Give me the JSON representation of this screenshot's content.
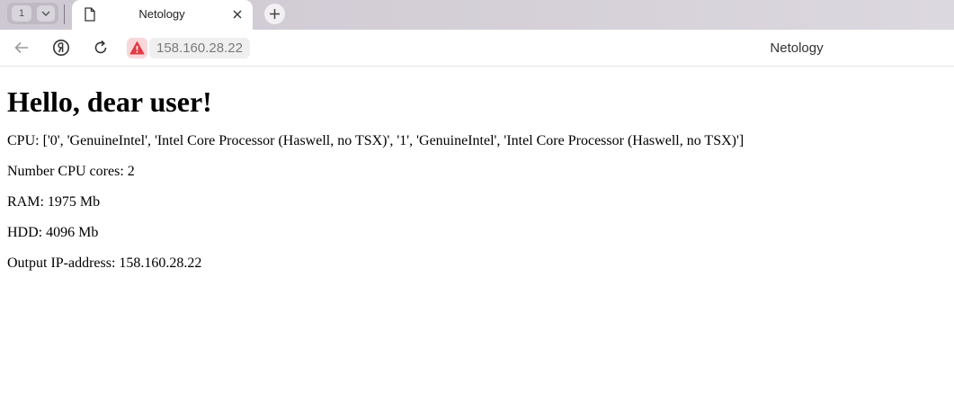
{
  "browser": {
    "tab_count": "1",
    "tabs": [
      {
        "label": "Netology"
      }
    ],
    "address": "158.160.28.22",
    "page_title": "Netology"
  },
  "page": {
    "heading": "Hello, dear user!",
    "lines": [
      "CPU: ['0', 'GenuineIntel', 'Intel Core Processor (Haswell, no TSX)', '1', 'GenuineIntel', 'Intel Core Processor (Haswell, no TSX)']",
      "Number CPU cores: 2",
      "RAM: 1975 Mb",
      "HDD: 4096 Mb",
      "Output IP-address: 158.160.28.22"
    ]
  },
  "icons": {
    "tab_menu": "chevron-down-icon",
    "tab_favicon": "document-icon",
    "tab_close": "close-icon",
    "new_tab": "plus-icon",
    "back": "arrow-left-icon",
    "browser_logo": "yandex-logo-icon",
    "reload": "reload-icon",
    "security": "warning-icon"
  },
  "colors": {
    "warning_bg": "#f8d7da",
    "warning_fg": "#e23a44"
  }
}
